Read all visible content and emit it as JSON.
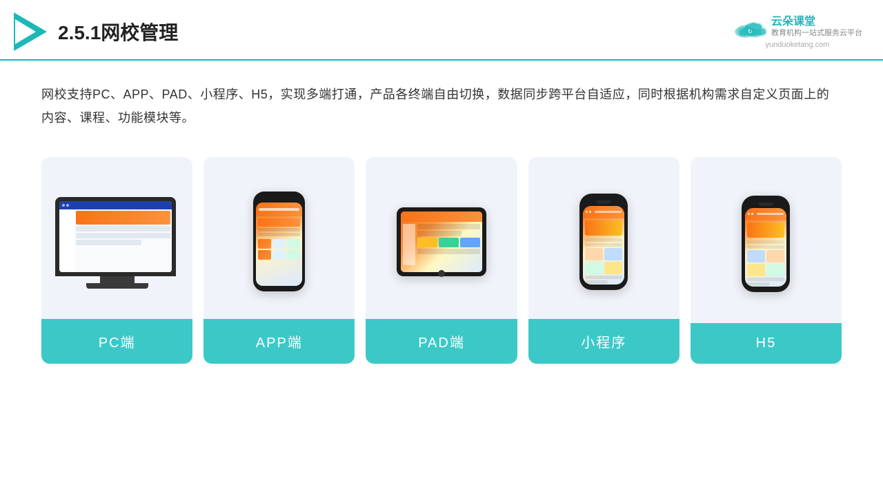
{
  "header": {
    "title": "2.5.1网校管理",
    "brand": {
      "name_cn": "云朵课堂",
      "tagline_line1": "教育机构一站",
      "tagline_line2": "式服务云平台",
      "url": "yunduoketang.com"
    }
  },
  "description": {
    "text": "网校支持PC、APP、PAD、小程序、H5，实现多端打通，产品各终端自由切换，数据同步跨平台自适应，同时根据机构需求自定义页面上的内容、课程、功能模块等。"
  },
  "cards": [
    {
      "id": "pc",
      "label": "PC端"
    },
    {
      "id": "app",
      "label": "APP端"
    },
    {
      "id": "pad",
      "label": "PAD端"
    },
    {
      "id": "miniprogram",
      "label": "小程序"
    },
    {
      "id": "h5",
      "label": "H5"
    }
  ],
  "colors": {
    "accent": "#1cb8b8",
    "card_bg": "#f0f4fa",
    "label_bg": "#3dc8c8"
  }
}
